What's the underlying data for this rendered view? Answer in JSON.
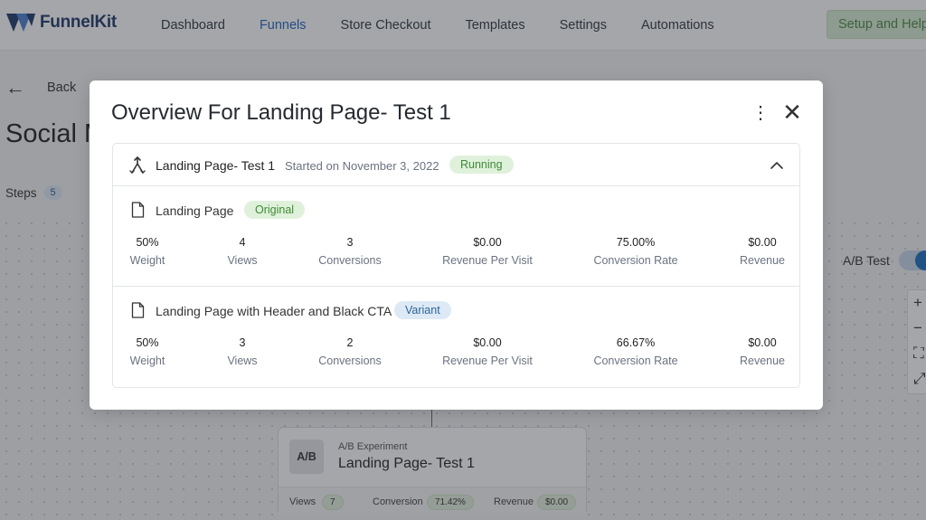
{
  "brand": {
    "name": "FunnelKit"
  },
  "nav": {
    "items": [
      "Dashboard",
      "Funnels",
      "Store Checkout",
      "Templates",
      "Settings",
      "Automations"
    ],
    "active": "Funnels",
    "setup_button": "Setup and Help"
  },
  "page": {
    "back_label": "Back",
    "title": "Social Media Funnel",
    "steps_label": "Steps",
    "steps_count": "5",
    "ab_test_label": "A/B Test"
  },
  "zoom_controls": [
    "+",
    "−",
    "⛶",
    "⤢"
  ],
  "node": {
    "badge": "A/B",
    "subtitle": "A/B Experiment",
    "title": "Landing Page- Test 1",
    "views_label": "Views",
    "views_value": "7",
    "conversion_label": "Conversion",
    "conversion_value": "71.42%",
    "revenue_label": "Revenue",
    "revenue_value": "$0.00"
  },
  "modal": {
    "title": "Overview For Landing Page- Test 1",
    "experiment": {
      "name": "Landing Page- Test 1",
      "started": "Started on November 3, 2022",
      "status": "Running"
    },
    "variants": [
      {
        "name": "Landing Page",
        "tag": "Original",
        "stats": [
          {
            "value": "50%",
            "label": "Weight"
          },
          {
            "value": "4",
            "label": "Views"
          },
          {
            "value": "3",
            "label": "Conversions"
          },
          {
            "value": "$0.00",
            "label": "Revenue Per Visit"
          },
          {
            "value": "75.00%",
            "label": "Conversion Rate"
          },
          {
            "value": "$0.00",
            "label": "Revenue"
          }
        ]
      },
      {
        "name": "Landing Page with Header and Black CTA",
        "tag": "Variant",
        "stats": [
          {
            "value": "50%",
            "label": "Weight"
          },
          {
            "value": "3",
            "label": "Views"
          },
          {
            "value": "2",
            "label": "Conversions"
          },
          {
            "value": "$0.00",
            "label": "Revenue Per Visit"
          },
          {
            "value": "66.67%",
            "label": "Conversion Rate"
          },
          {
            "value": "$0.00",
            "label": "Revenue"
          }
        ]
      }
    ]
  },
  "colors": {
    "brand_navy": "#1f3a6b",
    "nav_active": "#1d63c1",
    "success_green": "#3f8a36",
    "variant_blue": "#2d6698",
    "toggle_blue": "#1a6ebf"
  },
  "icons": [
    "funnelkit-logo-icon",
    "back-arrow-icon",
    "kebab-menu-icon",
    "close-icon",
    "ab-split-icon",
    "chevron-up-icon",
    "file-icon"
  ]
}
